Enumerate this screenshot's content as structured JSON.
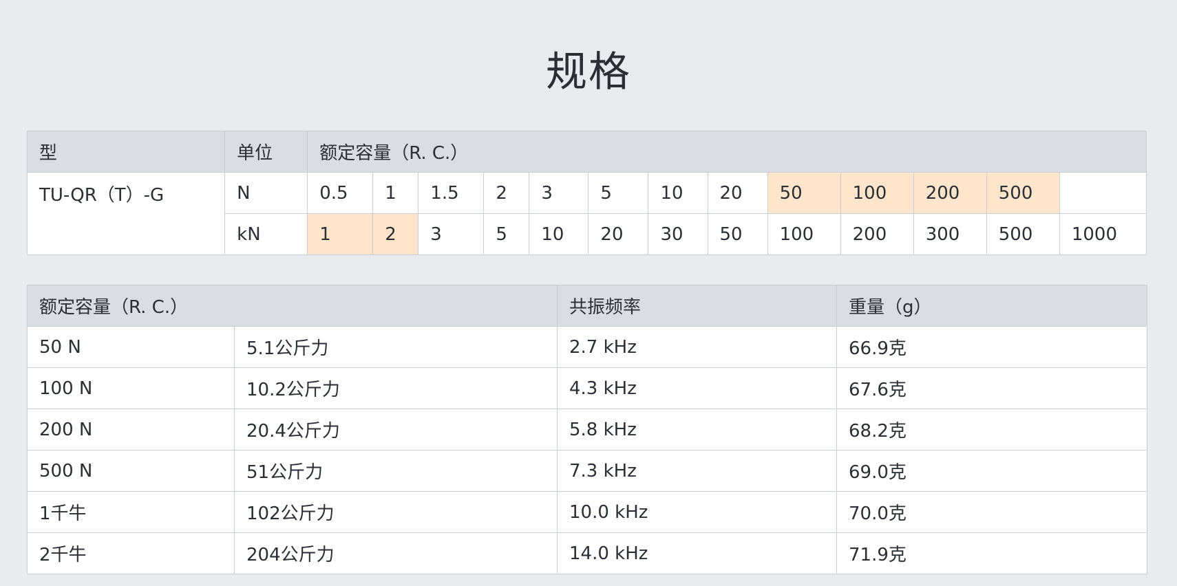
{
  "title": "规格",
  "spec": {
    "headers": {
      "type": "型",
      "unit": "单位",
      "capacity": "额定容量（R. C.）"
    },
    "model": "TU-QR（T）-G",
    "rows": [
      {
        "unit": "N",
        "values": [
          "0.5",
          "1",
          "1.5",
          "2",
          "3",
          "5",
          "10",
          "20",
          "50",
          "100",
          "200",
          "500",
          ""
        ],
        "highlight": [
          8,
          9,
          10,
          11
        ]
      },
      {
        "unit": "kN",
        "values": [
          "1",
          "2",
          "3",
          "5",
          "10",
          "20",
          "30",
          "50",
          "100",
          "200",
          "300",
          "500",
          "1000"
        ],
        "highlight": [
          0,
          1
        ]
      }
    ],
    "highlight_color": "#ffe5cb"
  },
  "detail": {
    "headers": {
      "capacity": "额定容量（R. C.）",
      "frequency": "共振频率",
      "weight": "重量（g）"
    },
    "rows": [
      {
        "capacity": "50 N",
        "kgf": "5.1公斤力",
        "frequency": "2.7 kHz",
        "weight": "66.9克"
      },
      {
        "capacity": "100 N",
        "kgf": "10.2公斤力",
        "frequency": "4.3 kHz",
        "weight": "67.6克"
      },
      {
        "capacity": "200 N",
        "kgf": "20.4公斤力",
        "frequency": "5.8 kHz",
        "weight": "68.2克"
      },
      {
        "capacity": "500 N",
        "kgf": "51公斤力",
        "frequency": "7.3 kHz",
        "weight": "69.0克"
      },
      {
        "capacity": "1千牛",
        "kgf": "102公斤力",
        "frequency": "10.0 kHz",
        "weight": "70.0克"
      },
      {
        "capacity": "2千牛",
        "kgf": "204公斤力",
        "frequency": "14.0 kHz",
        "weight": "71.9克"
      }
    ]
  }
}
